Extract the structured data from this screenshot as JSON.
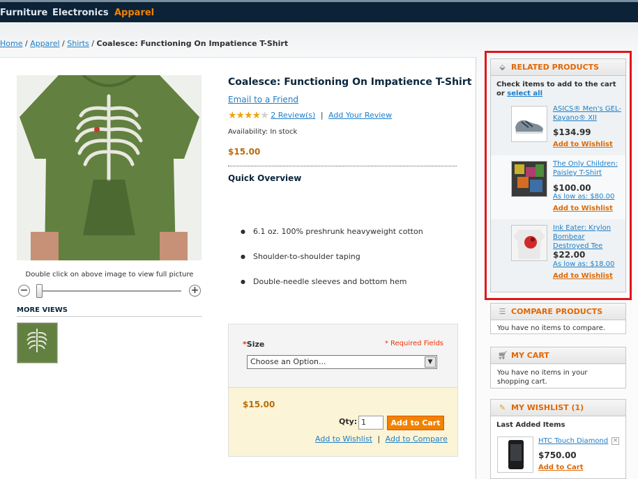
{
  "nav": {
    "items": [
      {
        "label": "Furniture",
        "active": false
      },
      {
        "label": "Electronics",
        "active": false
      },
      {
        "label": "Apparel",
        "active": true
      }
    ]
  },
  "breadcrumb": {
    "home": "Home",
    "apparel": "Apparel",
    "shirts": "Shirts",
    "current": "Coalesce: Functioning On Impatience T-Shirt"
  },
  "product": {
    "name": "Coalesce: Functioning On Impatience T-Shirt",
    "email_friend": "Email to a Friend",
    "rating": {
      "stars_filled": 4,
      "stars_total": 5
    },
    "reviews_link": "2 Review(s)",
    "add_review_link": "Add Your Review",
    "availability": "Availability: In stock",
    "price": "$15.00",
    "quick_overview_title": "Quick Overview",
    "features": [
      "6.1 oz. 100% preshrunk heavyweight cotton",
      "Shoulder-to-shoulder taping",
      "Double-needle sleeves and bottom hem"
    ],
    "image_hint": "Double click on above image to view full picture",
    "more_views_title": "MORE VIEWS",
    "zoom_level": 0
  },
  "options": {
    "size_label": "Size",
    "required_star": "*",
    "required_fields": "* Required Fields",
    "size_select_value": "Choose an Option..."
  },
  "cart_box": {
    "price": "$15.00",
    "qty_label": "Qty:",
    "qty_value": "1",
    "add_to_cart": "Add to Cart",
    "add_to_wishlist": "Add to Wishlist",
    "separator": "|",
    "add_to_compare": "Add to Compare"
  },
  "related": {
    "title": "RELATED PRODUCTS",
    "intro": "Check items to add to the cart or",
    "select_all": "select all",
    "items": [
      {
        "name": "ASICS® Men's GEL-Kayano® XII",
        "price": "$134.99",
        "as_low_as": "",
        "wishlist": "Add to Wishlist"
      },
      {
        "name": "The Only Children: Paisley T-Shirt",
        "price": "$100.00",
        "as_low_as": "As low as: $80.00",
        "wishlist": "Add to Wishlist"
      },
      {
        "name": "Ink Eater: Krylon Bombear Destroyed Tee",
        "price": "$22.00",
        "as_low_as": "As low as: $18.00",
        "wishlist": "Add to Wishlist"
      }
    ]
  },
  "compare": {
    "title": "COMPARE PRODUCTS",
    "text": "You have no items to compare."
  },
  "mycart": {
    "title": "MY CART",
    "text": "You have no items in your shopping cart."
  },
  "wishlist": {
    "title": "MY WISHLIST (1)",
    "subtitle": "Last Added Items",
    "item_name": "HTC Touch Diamond",
    "item_price": "$750.00",
    "add_to_cart": "Add to Cart"
  },
  "colors": {
    "nav_bg": "#0c2236",
    "accent_orange": "#f18200",
    "link_blue": "#1e7ec8",
    "price_brown": "#b86d0d",
    "highlight_red": "#e0151b"
  }
}
